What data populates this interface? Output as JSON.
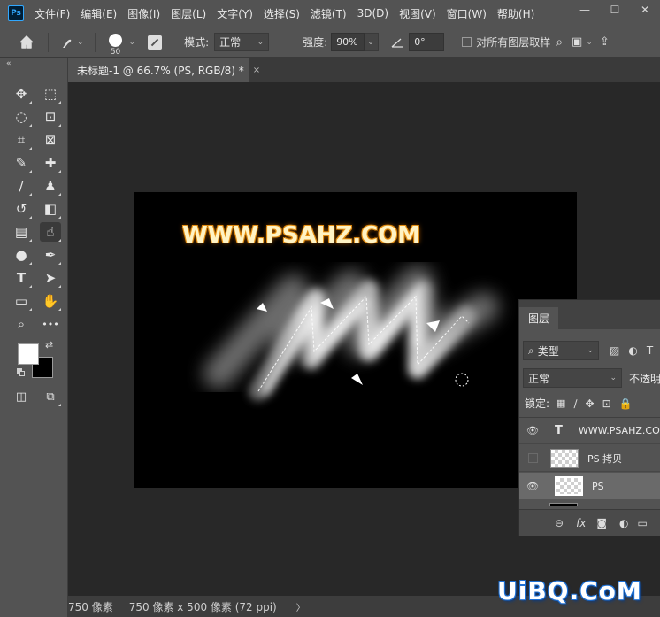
{
  "app": {
    "logo": "Ps"
  },
  "menu": [
    "文件(F)",
    "编辑(E)",
    "图像(I)",
    "图层(L)",
    "文字(Y)",
    "选择(S)",
    "滤镜(T)",
    "3D(D)",
    "视图(V)",
    "窗口(W)",
    "帮助(H)"
  ],
  "window_controls": {
    "minimize": "—",
    "maximize": "☐",
    "close": "✕"
  },
  "options": {
    "brush_size": "50",
    "mode_label": "模式:",
    "mode_value": "正常",
    "strength_label": "强度:",
    "strength_value": "90%",
    "angle_value": "0°",
    "sample_all_label": "对所有图层取样"
  },
  "tools": [
    {
      "name": "move-tool",
      "glyph": "✥"
    },
    {
      "name": "marquee-tool",
      "glyph": "⬚"
    },
    {
      "name": "lasso-tool",
      "glyph": "◌"
    },
    {
      "name": "object-select-tool",
      "glyph": "⊡"
    },
    {
      "name": "crop-tool",
      "glyph": "⌗"
    },
    {
      "name": "frame-tool",
      "glyph": "⊠"
    },
    {
      "name": "eyedropper-tool",
      "glyph": "✎"
    },
    {
      "name": "healing-tool",
      "glyph": "✚"
    },
    {
      "name": "brush-tool",
      "glyph": "∕"
    },
    {
      "name": "stamp-tool",
      "glyph": "♟"
    },
    {
      "name": "history-brush-tool",
      "glyph": "↺"
    },
    {
      "name": "eraser-tool",
      "glyph": "◧"
    },
    {
      "name": "gradient-tool",
      "glyph": "▤"
    },
    {
      "name": "smudge-tool",
      "glyph": "☝"
    },
    {
      "name": "dodge-tool",
      "glyph": "●"
    },
    {
      "name": "pen-tool",
      "glyph": "✒"
    },
    {
      "name": "type-tool",
      "glyph": "T"
    },
    {
      "name": "path-select-tool",
      "glyph": "➤"
    },
    {
      "name": "rectangle-tool",
      "glyph": "▭"
    },
    {
      "name": "hand-tool",
      "glyph": "✋"
    },
    {
      "name": "zoom-tool",
      "glyph": "⌕"
    },
    {
      "name": "more-tools",
      "glyph": "•••"
    },
    {
      "name": "quick-mask-tool",
      "glyph": "◫"
    },
    {
      "name": "screen-mode-tool",
      "glyph": "⧉"
    }
  ],
  "tab": {
    "title": "未标题-1 @ 66.7% (PS, RGB/8) *",
    "close": "×"
  },
  "canvas": {
    "text": "WWW.PSAHZ.COM"
  },
  "status": {
    "left": "750 像素",
    "dims": "750 像素 x 500 像素 (72 ppi)",
    "arrow": "〉"
  },
  "layers_panel": {
    "tab": "图层",
    "filter_label": "类型",
    "blend": "正常",
    "opacity_label": "不透明",
    "lock_label": "锁定:",
    "layers": [
      {
        "name": "WWW.PSAHZ.CO",
        "type": "text",
        "visible": true,
        "selected": false
      },
      {
        "name": "PS 拷贝",
        "type": "pixel",
        "visible": false,
        "selected": false
      },
      {
        "name": "PS",
        "type": "pixel",
        "visible": true,
        "selected": true
      }
    ],
    "footer_icons": [
      "link-icon",
      "fx-icon",
      "mask-icon",
      "adjustment-icon",
      "folder-icon"
    ]
  },
  "site_watermark": "UiBQ.CoM"
}
